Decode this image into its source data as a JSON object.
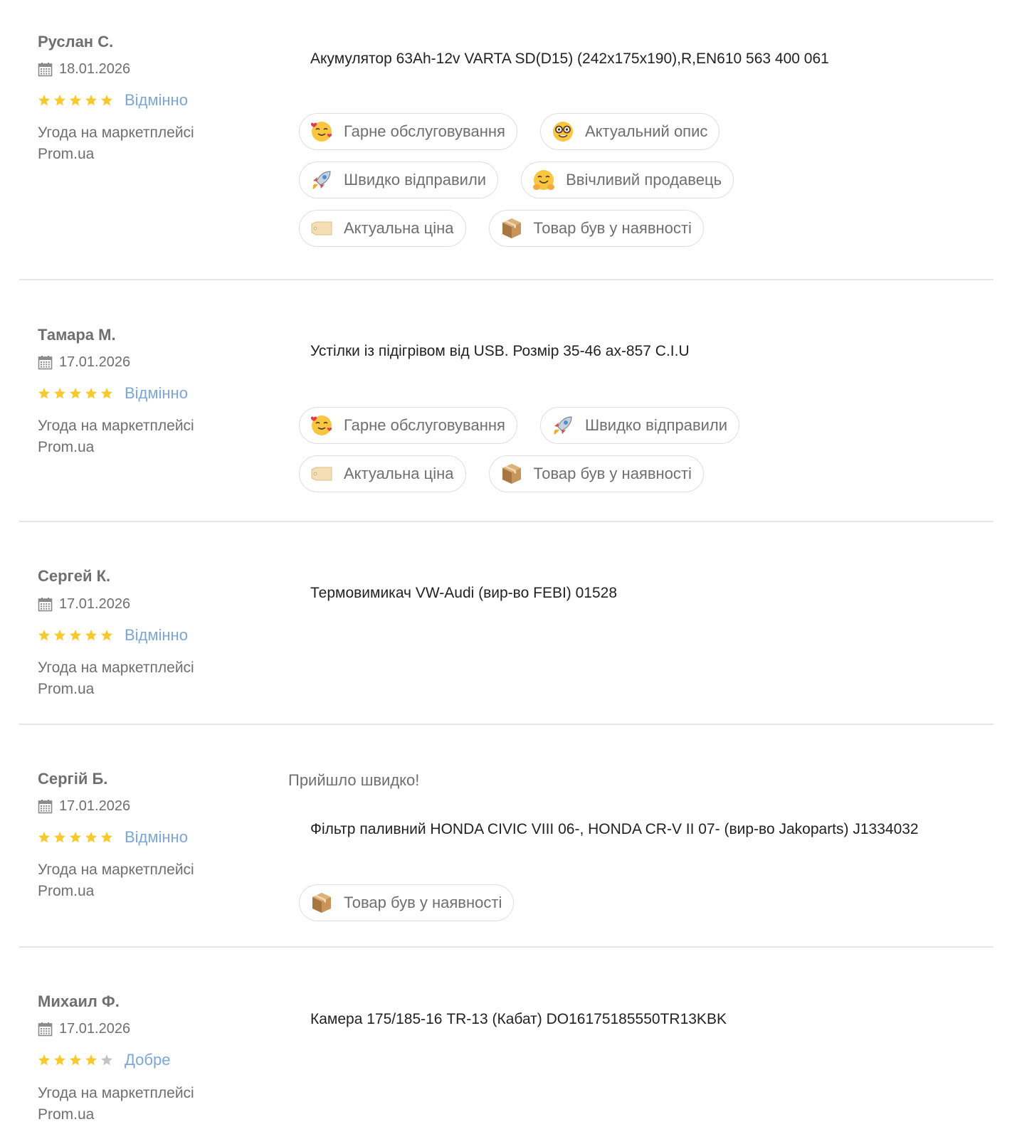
{
  "reviews": [
    {
      "author": "Руслан С.",
      "date": "18.01.2026",
      "stars": 5,
      "rating_label": "Відмінно",
      "deal_line1": "Угода на маркетплейсі",
      "deal_line2": "Prom.ua",
      "comment": "",
      "product": "Акумулятор 63Ah-12v VARTA SD(D15) (242х175х190),R,EN610 563 400 061",
      "tags": [
        {
          "icon": "smiling-face-with-hearts-icon",
          "label": "Гарне обслуговування"
        },
        {
          "icon": "nerd-face-icon",
          "label": "Актуальний опис"
        },
        {
          "icon": "rocket-icon",
          "label": "Швидко відправили"
        },
        {
          "icon": "hugging-face-icon",
          "label": "Ввічливий продавець"
        },
        {
          "icon": "price-tag-icon",
          "label": "Актуальна ціна"
        },
        {
          "icon": "package-icon",
          "label": "Товар був у наявності"
        }
      ]
    },
    {
      "author": "Тамара М.",
      "date": "17.01.2026",
      "stars": 5,
      "rating_label": "Відмінно",
      "deal_line1": "Угода на маркетплейсі",
      "deal_line2": "Prom.ua",
      "comment": "",
      "product": "Устілки із підігрівом від USB. Розмір 35-46 ах-857 C.I.U",
      "tags": [
        {
          "icon": "smiling-face-with-hearts-icon",
          "label": "Гарне обслуговування"
        },
        {
          "icon": "rocket-icon",
          "label": "Швидко відправили"
        },
        {
          "icon": "price-tag-icon",
          "label": "Актуальна ціна"
        },
        {
          "icon": "package-icon",
          "label": "Товар був у наявності"
        }
      ]
    },
    {
      "author": "Сергей К.",
      "date": "17.01.2026",
      "stars": 5,
      "rating_label": "Відмінно",
      "deal_line1": "Угода на маркетплейсі",
      "deal_line2": "Prom.ua",
      "comment": "",
      "product": "Термовимикач VW-Audi (вир-во FEBI) 01528",
      "tags": []
    },
    {
      "author": "Сергій Б.",
      "date": "17.01.2026",
      "stars": 5,
      "rating_label": "Відмінно",
      "deal_line1": "Угода на маркетплейсі",
      "deal_line2": "Prom.ua",
      "comment": "Прийшло швидко!",
      "product": "Фільтр паливний HONDA CIVIC VIII 06-, HONDA CR-V II 07- (вир-во Jakoparts) J1334032",
      "tags": [
        {
          "icon": "package-icon",
          "label": "Товар був у наявності"
        }
      ]
    },
    {
      "author": "Михаил Ф.",
      "date": "17.01.2026",
      "stars": 4,
      "rating_label": "Добре",
      "deal_line1": "Угода на маркетплейсі",
      "deal_line2": "Prom.ua",
      "comment": "",
      "product": "Камера 175/185-16 TR-13 (Кабат) DO16175185550TR13KBK",
      "tags": []
    }
  ],
  "colors": {
    "star_filled": "#f7c92c",
    "star_empty": "#c4c4c4",
    "rating_label": "#7aa7d8",
    "muted_text": "#6f6f6f",
    "divider": "#e6e6e6"
  }
}
